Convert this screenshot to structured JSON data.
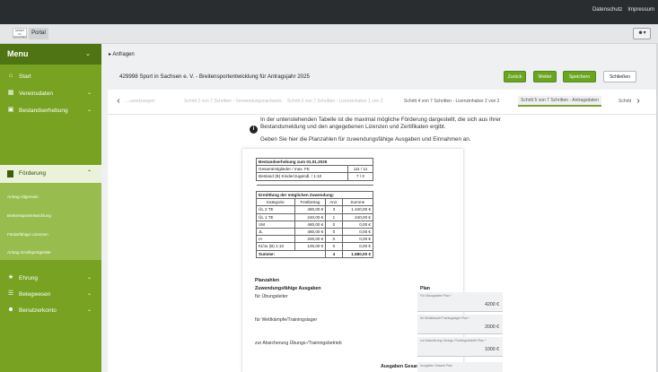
{
  "topbar": {
    "datenschutz": "Datenschutz",
    "impressum": "Impressum"
  },
  "portal": {
    "logo_text": "SPORT IN SACHSEN",
    "tab": "Portal",
    "user_icon": "user-icon"
  },
  "sidebar": {
    "menu_title": "Menu",
    "items": [
      {
        "label": "Start",
        "icon": "home-icon"
      },
      {
        "label": "Vereinsdaten",
        "icon": "building-icon"
      },
      {
        "label": "Bestandserhebung",
        "icon": "table-icon"
      }
    ],
    "foerderung": {
      "label": "Förderung",
      "icon": "book-icon"
    },
    "sub_items": [
      "Antrag Allgemein",
      "Breitensportentwicklung",
      "Förderfähige Lizenzen",
      "Antrag Großsportgeräte"
    ],
    "items2": [
      {
        "label": "Ehrung",
        "icon": "star-icon"
      },
      {
        "label": "Belegwesen",
        "icon": "list-icon"
      },
      {
        "label": "Benutzerkonto",
        "icon": "users-icon"
      }
    ]
  },
  "breadcrumb": "Anfragen",
  "page": {
    "title": "429998 Sport in Sachsen e. V. - Breitensportentwicklung für Antragsjahr 2025",
    "buttons": {
      "back": "Zurück",
      "next": "Weiter",
      "save": "Speichern",
      "close": "Schließen"
    }
  },
  "steps": [
    "...ussetzungen",
    "Schritt 2 von 7 Schritten - Verwendungsnachweis",
    "Schritt 3 von 7 Schritten - Lizenzinhaber 1 von 2",
    "Schritt 4 von 7 Schritten - Lizenzinhaber 2 von 2",
    "Schritt 5 von 7 Schritten - Antragsdaten",
    "Schritt"
  ],
  "info": {
    "text1": "In der untenstehenden Tabelle ist die maximal mögliche Förderung dargestellt, die sich aus Ihrer Bestandsmeldung und den angegebenen Lizenzen und Zertifikaten ergibt.",
    "text2": "Geben Sie hier die Planzahlen für zuwendungsfähige Ausgaben und Einnahmen an."
  },
  "bestand": {
    "title": "Bestandserhebung zum 01.01.2025",
    "rows": [
      {
        "label": "Gesamtmitglieder / max. FE",
        "value": "111 / 11"
      },
      {
        "label": "Bestand (B) Kinder/Jugendl. / 1:10",
        "value": "7 / 0"
      }
    ]
  },
  "zuwendung": {
    "title": "Ermittlung der möglichen Zuwendung:",
    "headers": [
      "Kategorie",
      "Festbetrag",
      "Anz.",
      "Summe"
    ],
    "rows": [
      [
        "ÜL 2 TE",
        "480,00 €",
        "3",
        "1.440,00 €"
      ],
      [
        "ÜL 1 TE",
        "240,00 €",
        "1",
        "240,00 €"
      ],
      [
        "VM",
        "480,00 €",
        "0",
        "0,00 €"
      ],
      [
        "JL",
        "480,00 €",
        "0",
        "0,00 €"
      ],
      [
        "IA",
        "200,00 €",
        "0",
        "0,00 €"
      ],
      [
        "KI/Ju (B) 1:10",
        "100,00 €",
        "0",
        "0,00 €"
      ]
    ],
    "sum_label": "Summe:",
    "sum_count": "4",
    "sum_value": "1.680,00 €"
  },
  "plan": {
    "heading": "Planzahlen",
    "sub_heading": "Zuwendungsfähige Ausgaben",
    "col_heading": "Plan",
    "fields": [
      {
        "label": "für Übungsleiter",
        "placeholder": "Für Übungsleiter Plan *",
        "value": "4200 €"
      },
      {
        "label": "für Wettkämpfe/Trainingslager",
        "placeholder": "für Wettkämpfe/Trainingslager Plan *",
        "value": "2000 €"
      },
      {
        "label": "zur Absicherung Übungs-/Trainingsbetrieb",
        "placeholder": "zur Absicherung Übungs-/Trainingsbetrieb Plan *",
        "value": "1000 €"
      }
    ],
    "total_label": "Ausgaben Gesamt",
    "total_placeholder": "Ausgaben Gesamt Plan"
  }
}
